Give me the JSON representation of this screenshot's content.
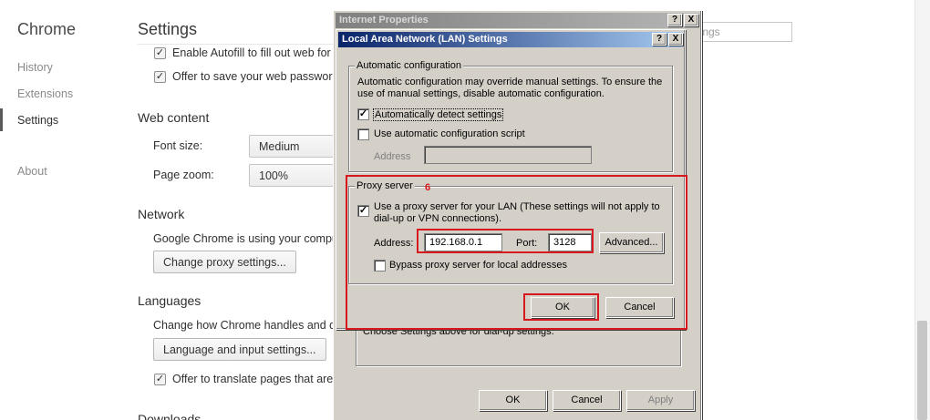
{
  "chrome": {
    "brand": "Chrome",
    "nav": {
      "history": "History",
      "extensions": "Extensions",
      "settings": "Settings",
      "about": "About"
    },
    "page_title": "Settings",
    "search_placeholder": "ttings",
    "autofill_text": "Enable Autofill to fill out web for",
    "passwords_text": "Offer to save your web passwor",
    "web_content": {
      "heading": "Web content",
      "font_size_label": "Font size:",
      "font_size_value": "Medium",
      "page_zoom_label": "Page zoom:",
      "page_zoom_value": "100%"
    },
    "network": {
      "heading": "Network",
      "description": "Google Chrome is using your compu",
      "button": "Change proxy settings..."
    },
    "languages": {
      "heading": "Languages",
      "description": "Change how Chrome handles and di",
      "button": "Language and input settings...",
      "translate_text": "Offer to translate pages that are"
    },
    "downloads_heading": "Downloads"
  },
  "internet_properties": {
    "title": "Internet Properties",
    "help_glyph": "?",
    "close_glyph": "X",
    "partial_text": "Choose Settings above for dial-up settings.",
    "ok": "OK",
    "cancel": "Cancel",
    "apply": "Apply"
  },
  "lan_dialog": {
    "title": "Local Area Network (LAN) Settings",
    "help_glyph": "?",
    "close_glyph": "X",
    "auto_config": {
      "legend": "Automatic configuration",
      "description_line1": "Automatic configuration may override manual settings.  To ensure the",
      "description_line2": "use of manual settings, disable automatic configuration.",
      "auto_detect_label": "Automatically detect settings",
      "auto_detect_checked": true,
      "use_script_label": "Use automatic configuration script",
      "use_script_checked": false,
      "address_label": "Address",
      "address_value": ""
    },
    "proxy": {
      "legend": "Proxy server",
      "annotation": "6",
      "use_proxy_line1": "Use a proxy server for your LAN (These settings will not apply to",
      "use_proxy_line2": "dial-up or VPN connections).",
      "use_proxy_checked": true,
      "address_label": "Address:",
      "address_value": "192.168.0.1",
      "port_label": "Port:",
      "port_value": "3128",
      "advanced_button": "Advanced...",
      "bypass_label": "Bypass proxy server for local addresses",
      "bypass_checked": false
    },
    "ok": "OK",
    "cancel": "Cancel"
  },
  "colors": {
    "highlight_red": "#d7191f",
    "active_titlebar": "#0a246a",
    "dialog_face": "#d4d0c8"
  }
}
